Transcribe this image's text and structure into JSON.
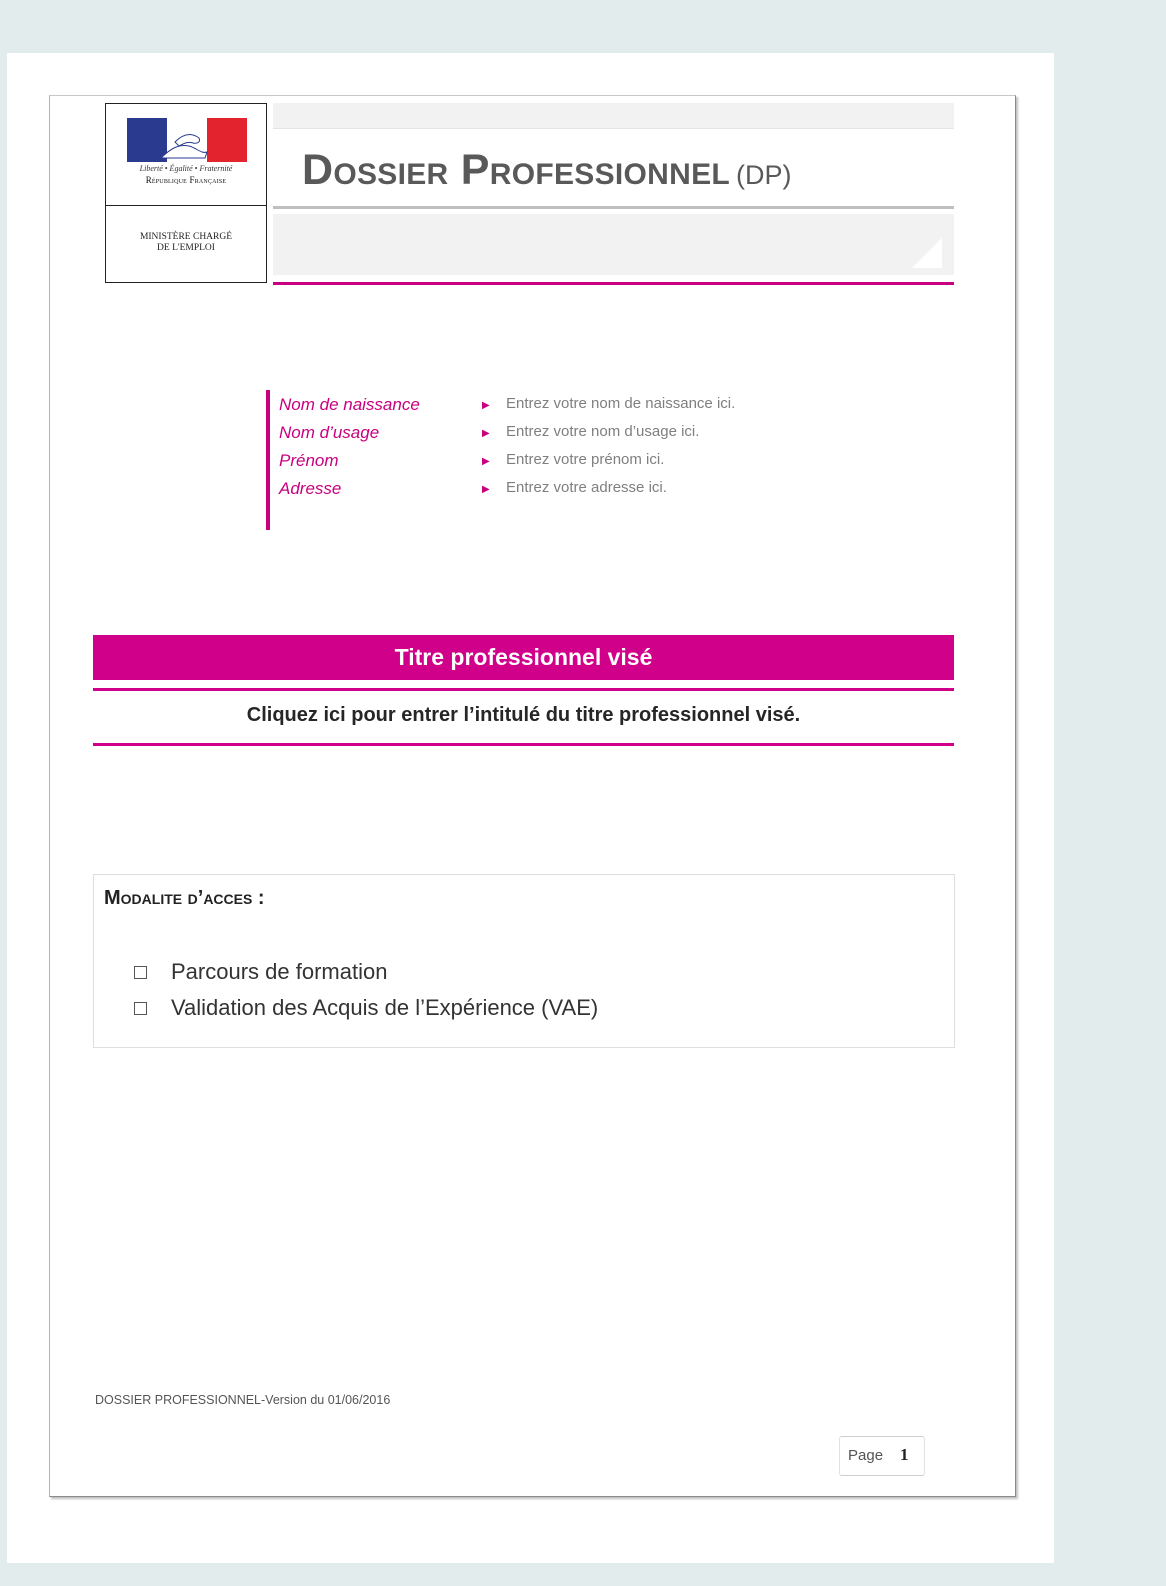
{
  "logo": {
    "motto": "Liberté • Égalité • Fraternité",
    "republic": "République Française",
    "ministry_line1": "MINISTÈRE CHARGÉ",
    "ministry_line2": "DE L'EMPLOI"
  },
  "header": {
    "title": "Dossier Professionnel",
    "abbr": "(DP)"
  },
  "identity": [
    {
      "label": "Nom de naissance",
      "value": "Entrez votre nom de naissance ici."
    },
    {
      "label": "Nom d’usage",
      "value": "Entrez votre nom d’usage ici."
    },
    {
      "label": "Prénom",
      "value": "Entrez votre prénom ici."
    },
    {
      "label": "Adresse",
      "value": "Entrez votre adresse ici."
    }
  ],
  "titre": {
    "banner": "Titre professionnel visé",
    "placeholder": "Cliquez ici pour entrer l’intitulé du titre professionnel visé."
  },
  "modalite": {
    "title": "Modalite d’acces :",
    "options": [
      {
        "label": "Parcours de formation",
        "checked": false
      },
      {
        "label": "Validation des Acquis de l’Expérience (VAE)",
        "checked": false
      }
    ]
  },
  "footer": {
    "version": "DOSSIER PROFESSIONNEL-Version du 01/06/2016",
    "page_label": "Page",
    "page_number": "1"
  },
  "colors": {
    "accent": "#d1008b",
    "page_background": "#e3ecec"
  }
}
